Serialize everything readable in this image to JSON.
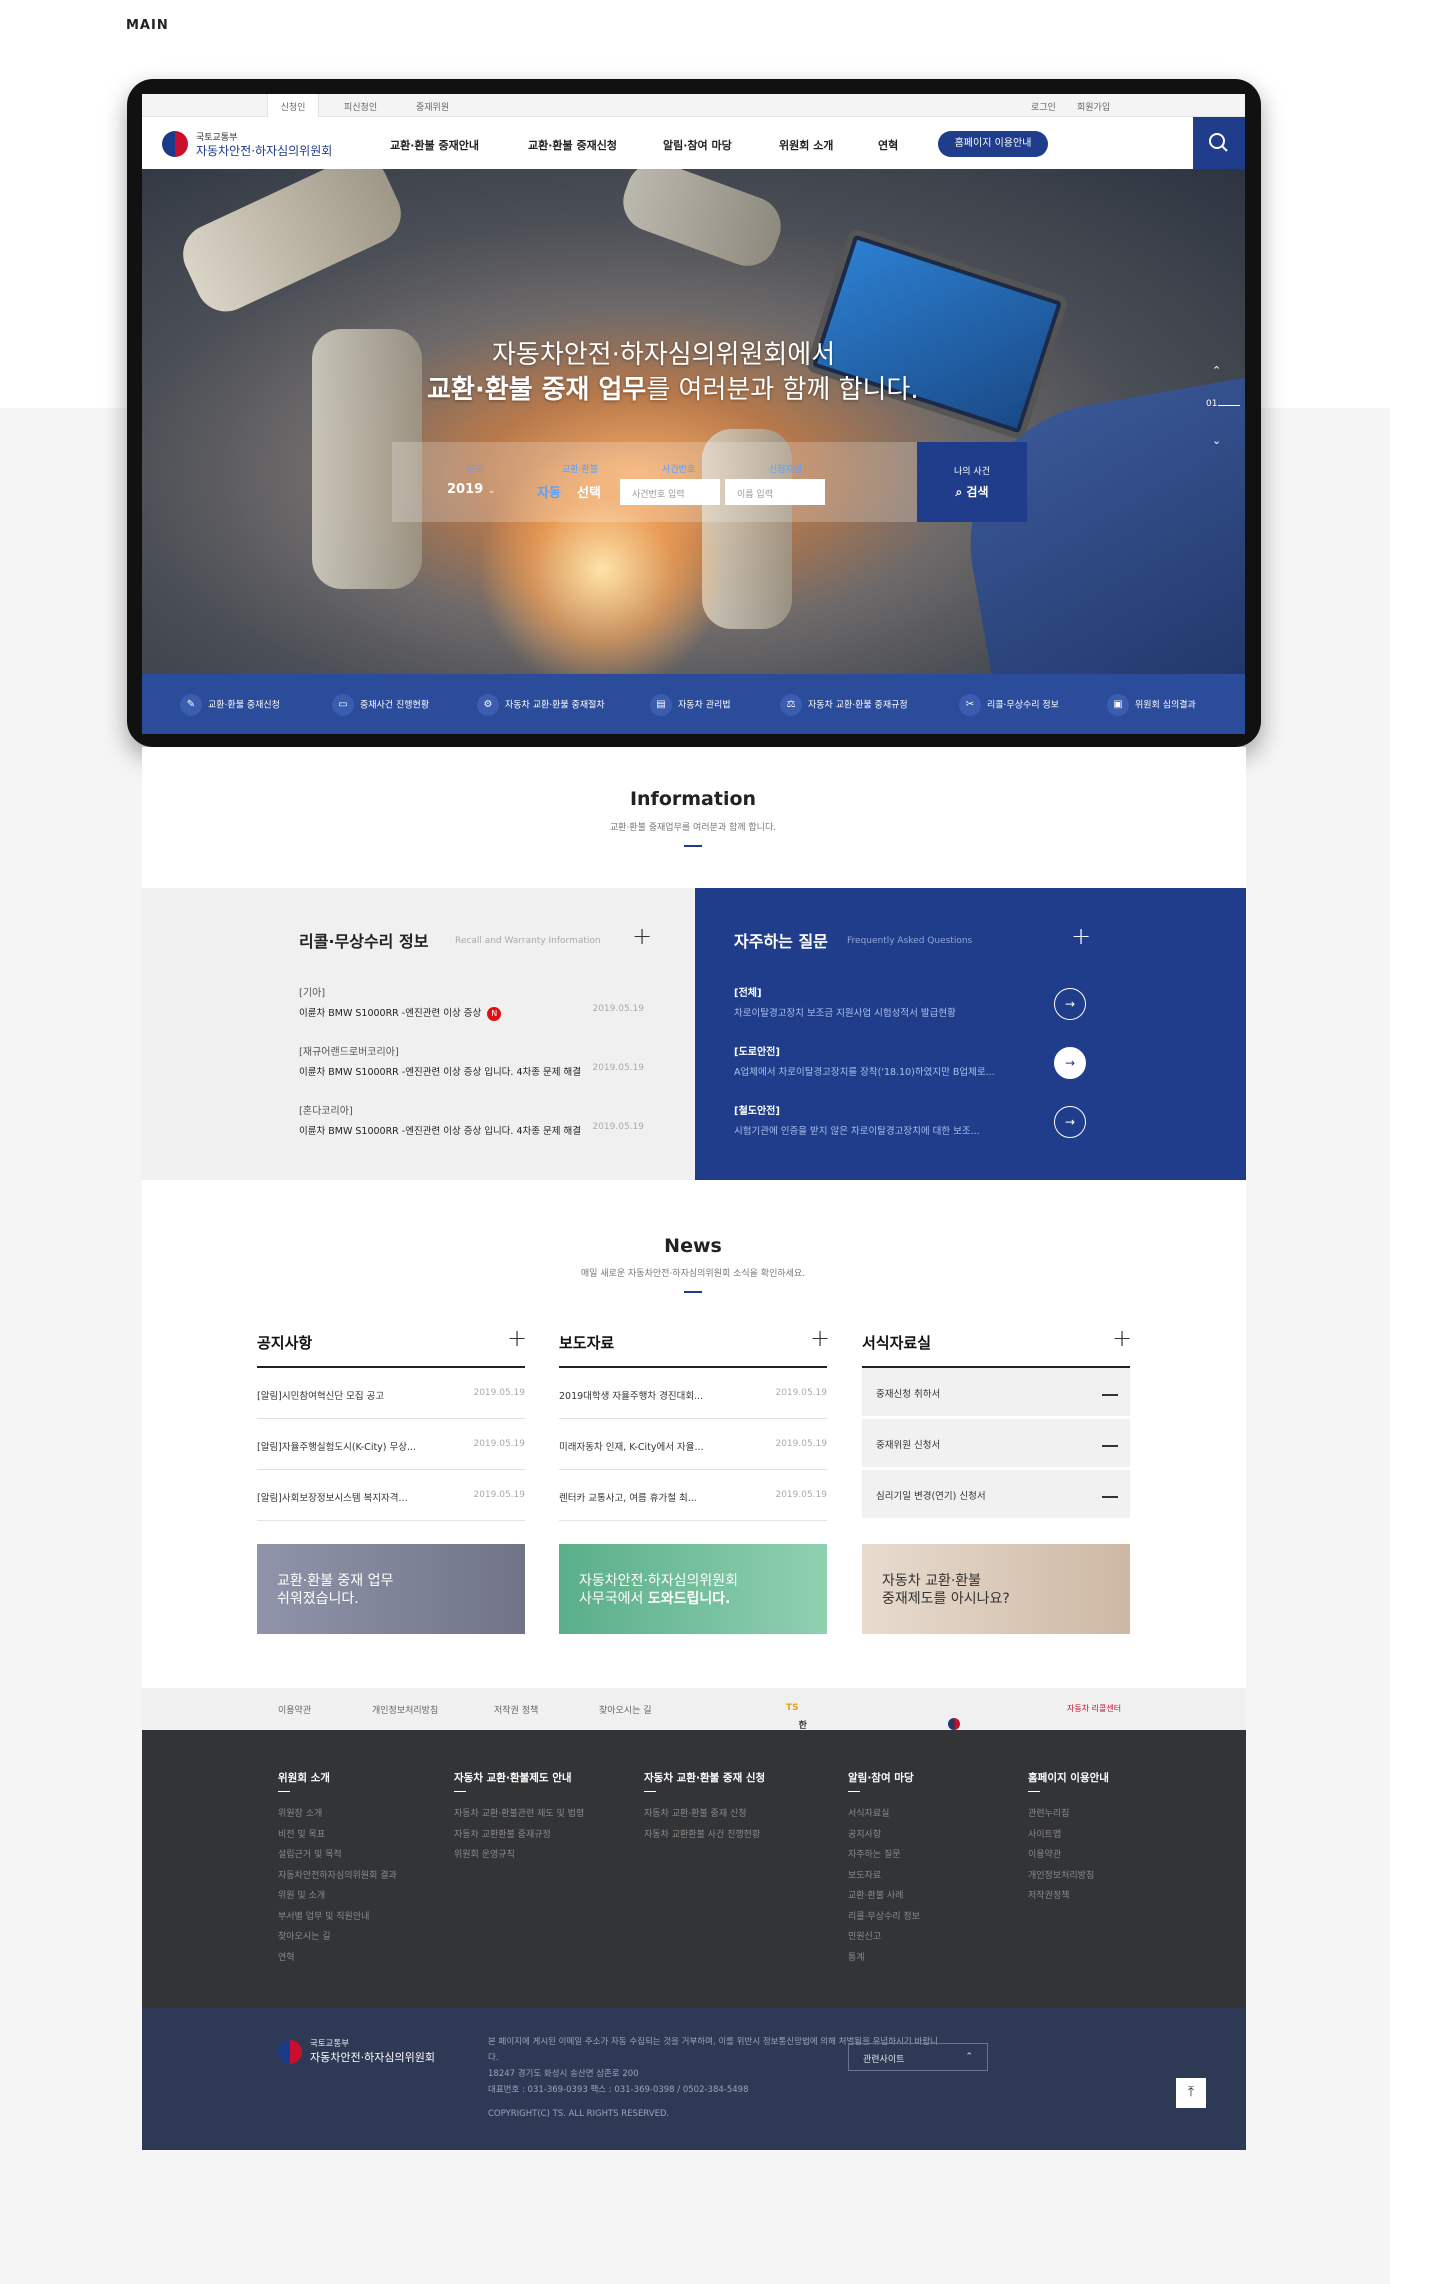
{
  "page_label": "MAIN",
  "util": {
    "tabs": [
      "신청인",
      "피신청인",
      "중재위원"
    ],
    "login": "로그인",
    "join": "회원가입"
  },
  "logo": {
    "ministry": "국토교통부",
    "name": "자동차안전·하자심의위원회"
  },
  "gnb": {
    "menu": [
      "교환·환불 중재안내",
      "교환·환불 중재신청",
      "알림·참여 마당",
      "위원회 소개",
      "연혁"
    ],
    "guide_button": "홈페이지 이용안내",
    "search_icon": "search-icon"
  },
  "hero": {
    "line1": "자동차안전·하자심의위원회에서",
    "line2_bold": "교환·환불 중재 업무",
    "line2_rest": "를 여러분과 함께 합니다.",
    "slide_index": "01",
    "search": {
      "year_label": "년도",
      "year_value": "2019",
      "type_label": "교환·환불",
      "type_value1": "자동",
      "type_value2": "선택",
      "case_label": "사건번호",
      "case_placeholder": "사건번호 입력",
      "name_label": "신청자명",
      "name_placeholder": "이름 입력",
      "my_case": "나의 사건",
      "search_button": "검색"
    }
  },
  "quick": [
    {
      "label": "교환·환불 중재신청",
      "icon": "edit-icon"
    },
    {
      "label": "중재사건 진행현황",
      "icon": "monitor-icon"
    },
    {
      "label": "자동차 교환·환불 중재절차",
      "icon": "process-icon"
    },
    {
      "label": "자동차 관리법",
      "icon": "document-icon"
    },
    {
      "label": "자동차 교환·환불 중재규정",
      "icon": "scale-icon"
    },
    {
      "label": "리콜·무상수리 정보",
      "icon": "tools-icon"
    },
    {
      "label": "위원회 심의결과",
      "icon": "result-icon"
    }
  ],
  "info": {
    "title": "Information",
    "subtitle": "교환·환불 중재업무를 여러분과 함께 합니다.",
    "recall": {
      "title": "리콜·무상수리 정보",
      "en": "Recall and Warranty Information",
      "items": [
        {
          "company": "[기아]",
          "desc": "이륜차 BMW S1000RR -엔진관련 이상 증상",
          "date": "2019.05.19",
          "badge": "N"
        },
        {
          "company": "[재규어랜드로버코리아]",
          "desc": "이륜차 BMW S1000RR -엔진관련 이상 증상 입니다. 4차종 문제 해결",
          "date": "2019.05.19"
        },
        {
          "company": "[혼다코리아]",
          "desc": "이륜차 BMW S1000RR -엔진관련 이상 증상 입니다. 4차종 문제 해결",
          "date": "2019.05.19"
        }
      ]
    },
    "faq": {
      "title": "자주하는 질문",
      "en": "Frequently Asked Questions",
      "items": [
        {
          "cat": "[전체]",
          "desc": "차로이탈경고장치 보조금 지원사업 시험성적서 발급현황"
        },
        {
          "cat": "[도로안전]",
          "desc": "A업체에서 차로이탈경고장치를 장착('18.10)하였지만 B업체로..."
        },
        {
          "cat": "[철도안전]",
          "desc": "시험기관에 인증을 받지 않은 차로이탈경고장치에 대한 보조..."
        }
      ]
    }
  },
  "news": {
    "title": "News",
    "subtitle": "매일 새로운 자동차안전·하자심의위원회 소식을 확인하세요.",
    "notice": {
      "title": "공지사항",
      "items": [
        {
          "t": "[알림]시민참여혁신단 모집 공고",
          "d": "2019.05.19"
        },
        {
          "t": "[알림]자율주행실험도시(K-City) 무상...",
          "d": "2019.05.19"
        },
        {
          "t": "[알림]사회보장정보시스템 복지자격...",
          "d": "2019.05.19"
        }
      ]
    },
    "press": {
      "title": "보도자료",
      "items": [
        {
          "t": "2019대학생 자율주행차 경진대회...",
          "d": "2019.05.19"
        },
        {
          "t": "미래자동차 인재, K-City에서 자율...",
          "d": "2019.05.19"
        },
        {
          "t": "렌터카 교통사고, 여름 휴가철 최...",
          "d": "2019.05.19"
        }
      ]
    },
    "forms": {
      "title": "서식자료실",
      "items": [
        "중재신청 취하서",
        "중재위원 신청서",
        "심리기일 변경(연기) 신청서"
      ]
    },
    "banners": [
      {
        "l1": "교환·환불 중재 업무",
        "l2": "쉬워졌습니다.",
        "color": "#8a8fa8"
      },
      {
        "l1": "자동차안전·하자심의위원회",
        "l2a": "사무국에서 ",
        "l2b": "도와드립니다.",
        "color": "#6dbd97"
      },
      {
        "l1": "자동차 교환·환불",
        "l2": "중재제도를 아시나요?",
        "color": "#e2d2c2"
      }
    ]
  },
  "footer": {
    "links": [
      "이용약관",
      "개인정보처리방침",
      "저작권 정책",
      "찾아오시는 길"
    ],
    "partners": [
      "한국교통안전공단",
      "국토교통부",
      "자동차 리콜센터"
    ],
    "cols": [
      {
        "h": "위원회 소개",
        "items": [
          "위원장 소개",
          "비전 및 목표",
          "설립근거 및 목적",
          "자동차안전하자심의위원회 결과",
          "위원 및 소개",
          "부서별 업무 및 직원안내",
          "찾아오시는 길",
          "연혁"
        ]
      },
      {
        "h": "자동차 교환·환불제도 안내",
        "items": [
          "자동차 교환·환불관련 제도 및 법령",
          "자동차 교환환불 중재규정",
          "위원회 운영규칙"
        ]
      },
      {
        "h": "자동차 교환·환불 중재 신청",
        "items": [
          "자동차 교환·환불 중재 신청",
          "자동차 교환환불 사건 진행현황"
        ]
      },
      {
        "h": "알림·참여 마당",
        "items": [
          "서식자료실",
          "공지사항",
          "자주하는 질문",
          "보도자료",
          "교환·환불 사례",
          "리콜·무상수리 정보",
          "민원신고",
          "통계"
        ]
      },
      {
        "h": "홈페이지 이용안내",
        "items": [
          "관련누리집",
          "사이트맵",
          "이용약관",
          "개인정보처리방침",
          "저작권정책"
        ]
      }
    ],
    "bottom": {
      "ministry": "국토교통부",
      "name": "자동차안전·하자심의위원회",
      "line1": "본 페이지에 게시된 이메일 주소가 자동 수집되는 것을 거부하며, 이를 위반시 정보통신망법에 의해 처벌됨을 유념하시기 바랍니다.",
      "line2": "18247 경기도 화성시 송산면 삼존로 200",
      "line3": "대표번호 : 031-369-0393 팩스 : 031-369-0398 / 0502-384-5498",
      "copyright": "COPYRIGHT(C) TS. ALL RIGHTS RESERVED.",
      "related": "관련사이트"
    }
  }
}
